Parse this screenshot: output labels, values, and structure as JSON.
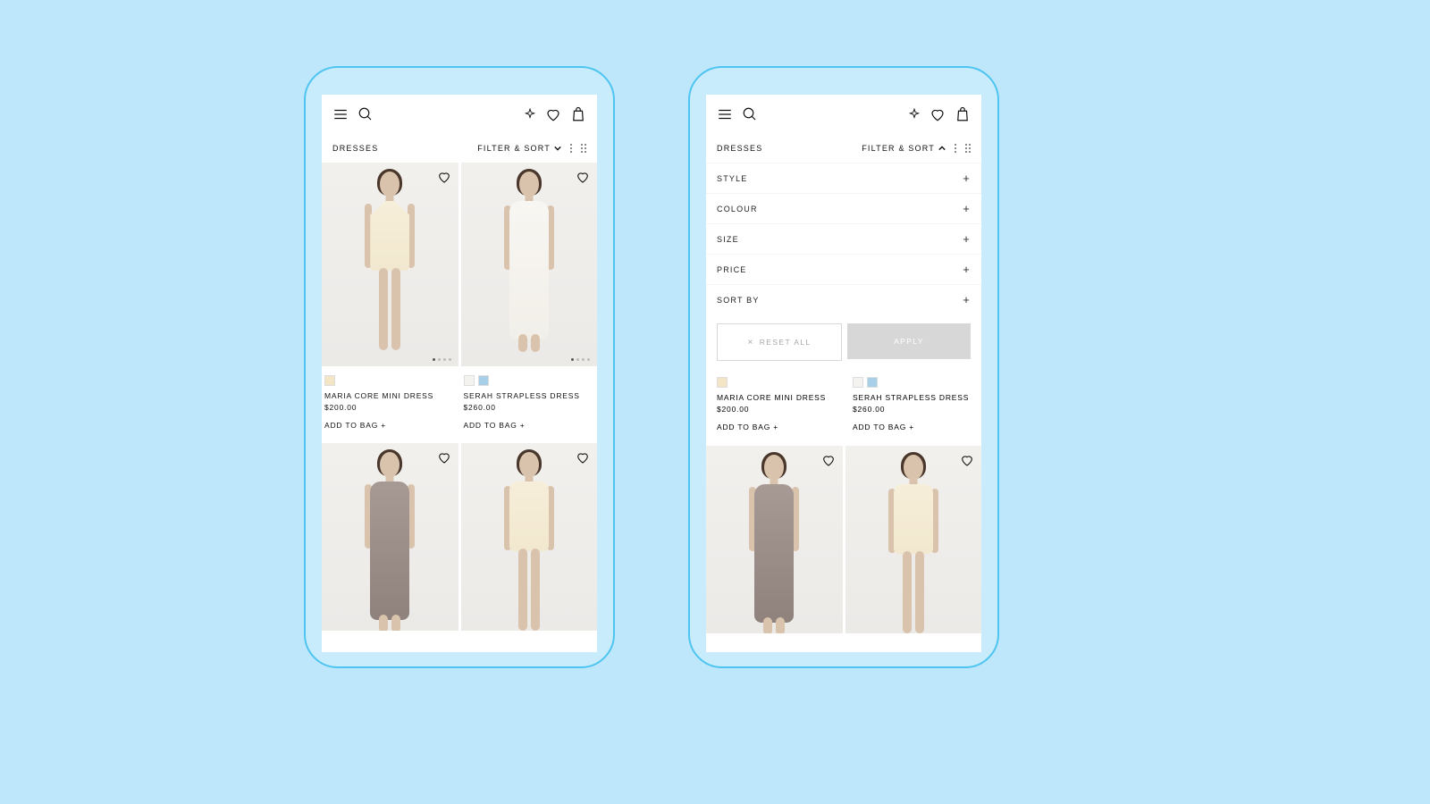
{
  "header": {
    "category": "DRESSES",
    "filter_sort_label": "FILTER & SORT"
  },
  "filters": {
    "rows": [
      "STYLE",
      "COLOUR",
      "SIZE",
      "PRICE",
      "SORT BY"
    ],
    "reset_label": "RESET ALL",
    "apply_label": "APPLY"
  },
  "products": [
    {
      "name": "MARIA CORE MINI DRESS",
      "price": "$200.00",
      "add_label": "ADD TO BAG +",
      "swatches": [
        "#f2e6c7"
      ],
      "fig_class": "mini halter",
      "dress_class": "dress-cream"
    },
    {
      "name": "SERAH STRAPLESS DRESS",
      "price": "$260.00",
      "add_label": "ADD TO BAG +",
      "swatches": [
        "#f5f3ef",
        "#a8cfe8"
      ],
      "fig_class": "midi strapless",
      "dress_class": "dress-white"
    },
    {
      "name": "",
      "price": "",
      "add_label": "",
      "swatches": [],
      "fig_class": "midi",
      "dress_class": "dress-mauve"
    },
    {
      "name": "",
      "price": "",
      "add_label": "",
      "swatches": [],
      "fig_class": "mini strapless",
      "dress_class": "dress-cream"
    }
  ]
}
